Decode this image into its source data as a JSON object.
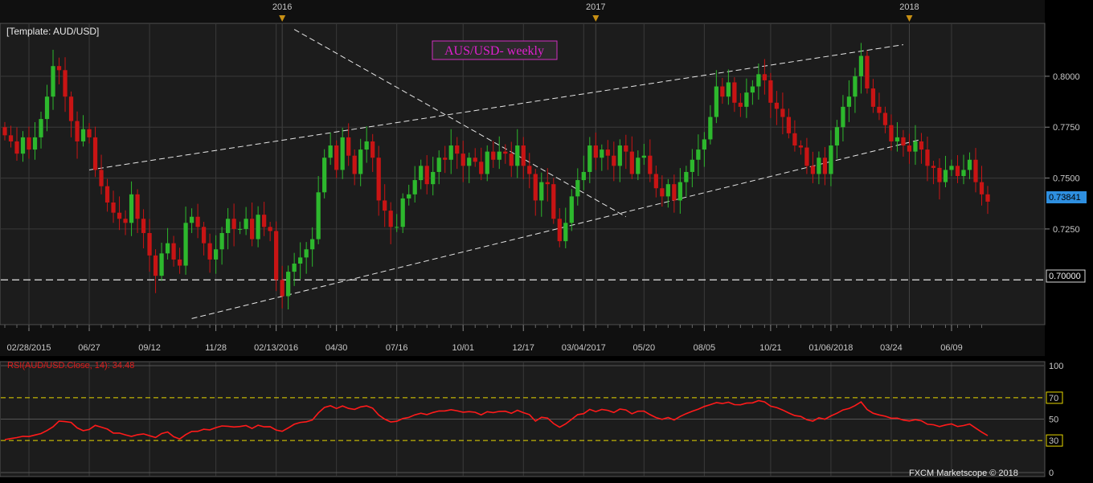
{
  "template_label": "[Template: AUD/USD]",
  "chart_title": "AUS/USD- weekly",
  "copyright": "FXCM Marketscope © 2018",
  "colors": {
    "background": "#000000",
    "panel": "#1c1c1c",
    "grid": "#3a3a3a",
    "up": "#2db82d",
    "down": "#c81414",
    "trendline": "#e6e6e6",
    "rsi_line": "#ff1a1a",
    "rsi_band": "#e8d800",
    "title_text": "#e020d0",
    "title_border": "#d030c0",
    "last_price_bg": "#2e8fe0",
    "year_marker": "#c89014"
  },
  "chart_data": [
    {
      "type": "candlestick",
      "title": "AUS/USD- weekly",
      "series_name": "AUD/USD",
      "year_markers": [
        "2016",
        "2017",
        "2018"
      ],
      "x_tick_labels": [
        "02/28/2015",
        "06/27",
        "09/12",
        "11/28",
        "02/13/2016",
        "04/30",
        "07/16",
        "10/01",
        "12/17",
        "03/04/2017",
        "05/20",
        "08/05",
        "10/21",
        "01/06/2018",
        "03/24",
        "06/09"
      ],
      "y_ticks": [
        0.725,
        0.75,
        0.775,
        0.8
      ],
      "y_tick_labels": [
        "0.7250",
        "0.7500",
        "0.7750",
        "0.8000"
      ],
      "ylim": [
        0.678,
        0.826
      ],
      "last_price": 0.73841,
      "last_price_label": "0.73841",
      "horizontal_level": 0.7,
      "horizontal_level_label": "0.70000",
      "grid": true,
      "closes": [
        0.771,
        0.768,
        0.762,
        0.77,
        0.764,
        0.77,
        0.779,
        0.79,
        0.805,
        0.803,
        0.79,
        0.778,
        0.768,
        0.774,
        0.77,
        0.754,
        0.746,
        0.738,
        0.733,
        0.73,
        0.728,
        0.742,
        0.73,
        0.723,
        0.712,
        0.702,
        0.713,
        0.718,
        0.71,
        0.707,
        0.728,
        0.731,
        0.726,
        0.718,
        0.71,
        0.715,
        0.723,
        0.73,
        0.725,
        0.725,
        0.73,
        0.72,
        0.732,
        0.726,
        0.724,
        0.7,
        0.692,
        0.704,
        0.708,
        0.711,
        0.715,
        0.72,
        0.743,
        0.76,
        0.766,
        0.754,
        0.77,
        0.761,
        0.752,
        0.764,
        0.768,
        0.76,
        0.739,
        0.734,
        0.726,
        0.726,
        0.74,
        0.742,
        0.749,
        0.756,
        0.747,
        0.753,
        0.76,
        0.759,
        0.766,
        0.762,
        0.756,
        0.76,
        0.758,
        0.752,
        0.763,
        0.759,
        0.763,
        0.762,
        0.756,
        0.766,
        0.756,
        0.752,
        0.739,
        0.748,
        0.747,
        0.73,
        0.719,
        0.728,
        0.741,
        0.749,
        0.753,
        0.766,
        0.76,
        0.764,
        0.761,
        0.756,
        0.766,
        0.763,
        0.752,
        0.76,
        0.761,
        0.752,
        0.745,
        0.741,
        0.747,
        0.739,
        0.748,
        0.753,
        0.759,
        0.764,
        0.769,
        0.78,
        0.795,
        0.79,
        0.797,
        0.787,
        0.785,
        0.792,
        0.795,
        0.801,
        0.798,
        0.787,
        0.784,
        0.78,
        0.772,
        0.766,
        0.765,
        0.756,
        0.752,
        0.76,
        0.752,
        0.766,
        0.775,
        0.785,
        0.79,
        0.8,
        0.81,
        0.794,
        0.785,
        0.782,
        0.776,
        0.768,
        0.77,
        0.766,
        0.763,
        0.768,
        0.764,
        0.756,
        0.755,
        0.748,
        0.754,
        0.756,
        0.751,
        0.754,
        0.759,
        0.748,
        0.742,
        0.7384
      ]
    },
    {
      "type": "line",
      "title": "RSI(AUD/USD.Close, 14): 34.48",
      "series_name": "RSI",
      "last_value": 34.48,
      "ylim": [
        0,
        100
      ],
      "y_tick_labels": [
        "100",
        "70",
        "50",
        "30",
        "0"
      ],
      "bands": [
        70,
        30
      ],
      "values": [
        30.8,
        31.8,
        32.7,
        33.9,
        33.7,
        35.1,
        36.5,
        39.3,
        42.8,
        48.2,
        47.7,
        46.9,
        41.8,
        39.2,
        40.3,
        44.1,
        42.5,
        40.7,
        36.9,
        36.9,
        35.3,
        33.8,
        35.4,
        36.2,
        34.4,
        32.8,
        36.5,
        38.0,
        33.5,
        31.4,
        35.5,
        38.5,
        38.6,
        40.5,
        39.9,
        42.0,
        43.6,
        43.3,
        42.6,
        43.1,
        44.0,
        41.3,
        44.3,
        42.8,
        42.9,
        39.8,
        38.6,
        41.7,
        45.2,
        46.9,
        47.5,
        49.2,
        55.9,
        60.9,
        62.5,
        59.9,
        62.3,
        60.0,
        59.1,
        61.4,
        62.3,
        60.2,
        53.8,
        50.0,
        47.3,
        48.0,
        50.5,
        51.6,
        54.0,
        55.5,
        54.2,
        56.2,
        57.6,
        57.7,
        58.8,
        57.8,
        56.5,
        57.0,
        56.4,
        54.0,
        56.9,
        56.1,
        57.2,
        57.4,
        55.4,
        58.3,
        56.0,
        54.2,
        48.1,
        51.7,
        51.0,
        45.9,
        42.4,
        45.5,
        49.8,
        54.2,
        55.1,
        59.1,
        57.0,
        59.0,
        58.2,
        56.2,
        59.4,
        58.6,
        55.0,
        57.4,
        57.5,
        54.2,
        51.4,
        49.8,
        51.5,
        49.2,
        52.5,
        55.1,
        57.3,
        59.3,
        61.8,
        63.5,
        65.4,
        64.6,
        65.8,
        63.5,
        63.4,
        65.0,
        65.2,
        67.3,
        66.1,
        62.1,
        60.8,
        58.5,
        55.7,
        53.3,
        52.5,
        49.4,
        48.1,
        51.2,
        49.9,
        53.0,
        55.5,
        58.6,
        59.9,
        62.6,
        66.1,
        59.0,
        55.5,
        53.9,
        52.7,
        50.8,
        50.9,
        49.1,
        48.3,
        49.5,
        48.4,
        45.2,
        44.7,
        43.0,
        44.5,
        45.5,
        43.1,
        44.0,
        45.4,
        41.6,
        37.8,
        34.48
      ]
    }
  ]
}
